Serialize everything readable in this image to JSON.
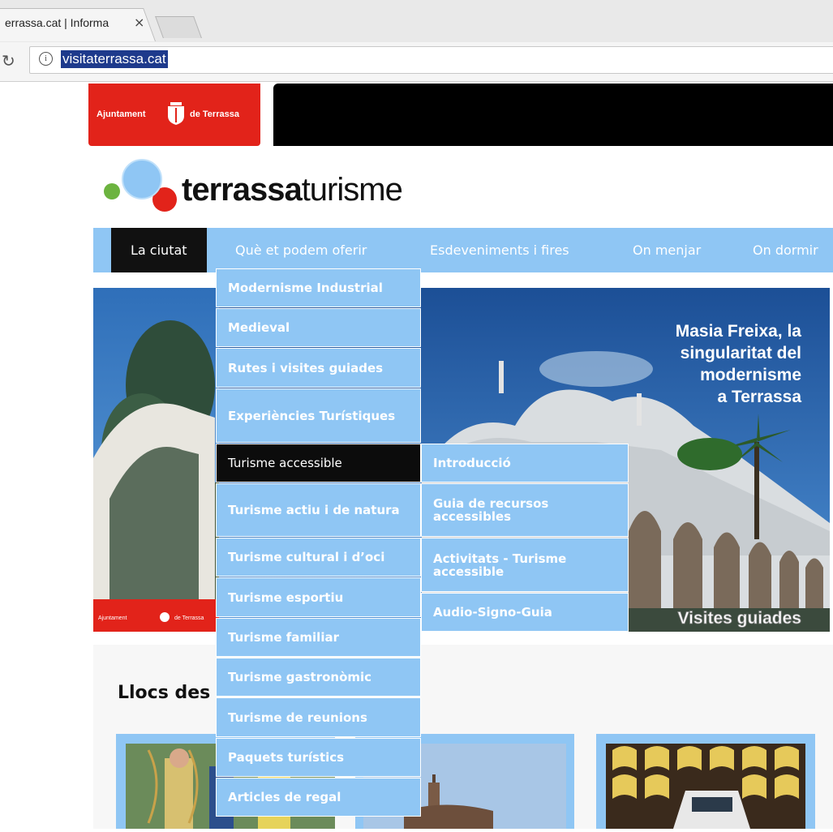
{
  "browser": {
    "tab_title": "errassa.cat | Informa",
    "tab_close": "×",
    "url": "visitaterrassa.cat",
    "info_glyph": "i",
    "reload_glyph": "↻"
  },
  "header": {
    "ajuntament_left": "Ajuntament",
    "ajuntament_right": "de Terrassa",
    "logo_bold": "terrassa",
    "logo_light": "turisme"
  },
  "nav": {
    "items": [
      "La ciutat",
      "Què et podem oferir",
      "Esdeveniments i fires",
      "On menjar",
      "On dormir"
    ],
    "active_index": 0
  },
  "menu": {
    "items": [
      "Modernisme Industrial",
      "Medieval",
      "Rutes i visites guiades",
      "Experiències Turístiques",
      "Turisme accessible",
      "Turisme actiu i de natura",
      "Turisme cultural i d’oci",
      "Turisme esportiu",
      "Turisme familiar",
      "Turisme gastronòmic",
      "Turisme de reunions",
      "Paquets turístics",
      "Articles de regal"
    ],
    "selected_index": 4
  },
  "submenu": {
    "items": [
      "Introducció",
      "Guia de recursos accessibles",
      "Activitats - Turisme accessible",
      "Audio-Signo-Guia"
    ]
  },
  "hero": {
    "headline": [
      "Masia Freixa, la",
      "singularitat del",
      "modernisme",
      "a Terrassa"
    ],
    "caption": "Visites guiades",
    "badge_left": "Ajuntament",
    "badge_right": "de Terrassa"
  },
  "content": {
    "section_title": "Llocs des"
  },
  "colors": {
    "nav_blue": "#8fc6f4",
    "brand_red": "#e2231a",
    "black": "#000000"
  }
}
